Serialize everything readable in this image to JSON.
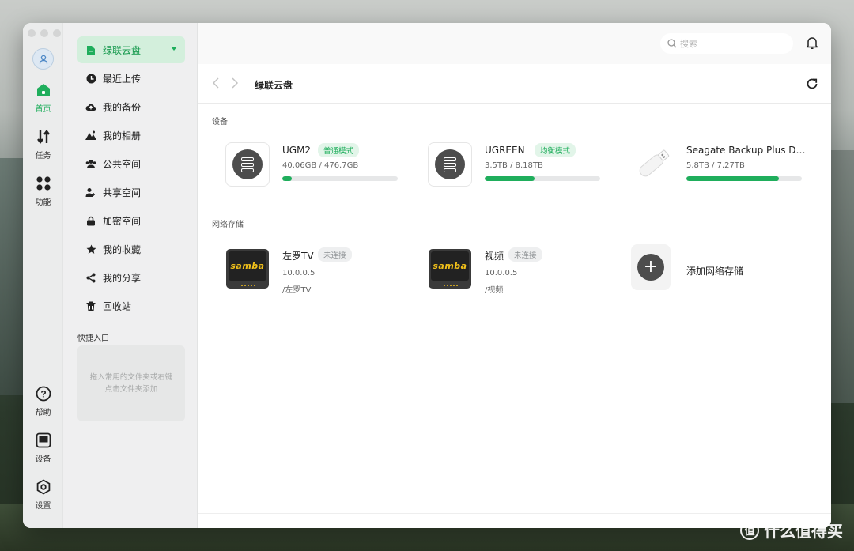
{
  "rail": {
    "items": [
      {
        "label": "首页",
        "icon": "home-icon"
      },
      {
        "label": "任务",
        "icon": "transfer-icon"
      },
      {
        "label": "功能",
        "icon": "apps-icon"
      },
      {
        "label": "帮助",
        "icon": "help-icon"
      },
      {
        "label": "设备",
        "icon": "device-icon"
      },
      {
        "label": "设置",
        "icon": "settings-icon"
      }
    ]
  },
  "sidebar": {
    "items": [
      {
        "label": "绿联云盘",
        "icon": "folder-icon"
      },
      {
        "label": "最近上传",
        "icon": "clock-icon"
      },
      {
        "label": "我的备份",
        "icon": "cloud-upload-icon"
      },
      {
        "label": "我的相册",
        "icon": "mountain-icon"
      },
      {
        "label": "公共空间",
        "icon": "group-icon"
      },
      {
        "label": "共享空间",
        "icon": "users-icon"
      },
      {
        "label": "加密空间",
        "icon": "lock-icon"
      },
      {
        "label": "我的收藏",
        "icon": "star-icon"
      },
      {
        "label": "我的分享",
        "icon": "share-icon"
      },
      {
        "label": "回收站",
        "icon": "trash-icon"
      }
    ],
    "quick_title": "快捷入口",
    "quick_hint": "拖入常用的文件夹或右键点击文件夹添加"
  },
  "header": {
    "search_placeholder": "搜索",
    "path_title": "绿联云盘"
  },
  "sections": {
    "devices_label": "设备",
    "network_label": "网络存储"
  },
  "devices": [
    {
      "name": "UGM2",
      "badge": "普通模式",
      "capacity": "40.06GB / 476.7GB",
      "used_fraction": 0.08
    },
    {
      "name": "UGREEN",
      "badge": "均衡模式",
      "capacity": "3.5TB / 8.18TB",
      "used_fraction": 0.43
    },
    {
      "name": "Seagate Backup Plus Dr...",
      "badge": "",
      "capacity": "5.8TB / 7.27TB",
      "used_fraction": 0.8
    }
  ],
  "network": [
    {
      "name": "左罗TV",
      "badge": "未连接",
      "ip": "10.0.0.5",
      "path": "/左罗TV",
      "logo_text": "samba"
    },
    {
      "name": "视频",
      "badge": "未连接",
      "ip": "10.0.0.5",
      "path": "/视频",
      "logo_text": "samba"
    }
  ],
  "add_network_label": "添加网络存储",
  "colors": {
    "accent": "#1fae5c",
    "accent_bg": "#d3efdc",
    "disconnected": "#8b8f92"
  },
  "watermark": {
    "text": "什么值得买",
    "logo": "值"
  }
}
